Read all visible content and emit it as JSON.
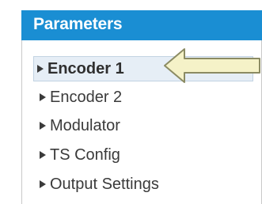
{
  "panel": {
    "title": "Parameters",
    "items": [
      {
        "label": "Encoder 1",
        "selected": true
      },
      {
        "label": "Encoder 2"
      },
      {
        "label": "Modulator"
      },
      {
        "label": "TS Config"
      },
      {
        "label": "Output Settings"
      }
    ]
  },
  "colors": {
    "header_bg": "#1a8ed3",
    "selected_bg": "#e6eef6",
    "arrow_fill": "#f5f2c8",
    "arrow_stroke": "#8b8b63"
  },
  "annotation": {
    "icon": "left-arrow-callout-icon"
  }
}
